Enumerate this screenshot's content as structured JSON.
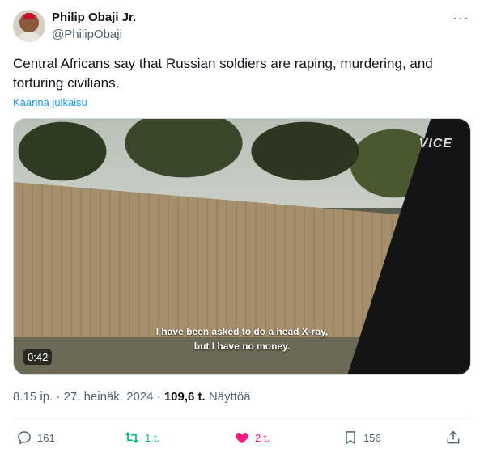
{
  "author": {
    "name": "Philip Obaji Jr.",
    "handle": "@PhilipObaji",
    "more_icon": "more-horizontal-icon"
  },
  "tweet": {
    "text": "Central Africans say that Russian soldiers are raping, murdering, and torturing civilians.",
    "translate_label": "Käännä julkaisu"
  },
  "media": {
    "logo": "VICE",
    "subtitle_line1": "I have been asked to do a head X-ray,",
    "subtitle_line2": "but I have no money.",
    "duration": "0:42"
  },
  "meta": {
    "time": "8.15 ip.",
    "separator": " · ",
    "date": "27. heinäk. 2024",
    "separator2": " · ",
    "views": "109,6 t.",
    "views_label": "Näyttöä"
  },
  "actions": {
    "replies": "161",
    "retweets": "1 t.",
    "likes": "2 t.",
    "bookmarks": "156"
  },
  "colors": {
    "accent": "#1d9bf0",
    "retweet": "#00ba7c",
    "like": "#f91880",
    "muted": "#536471"
  }
}
